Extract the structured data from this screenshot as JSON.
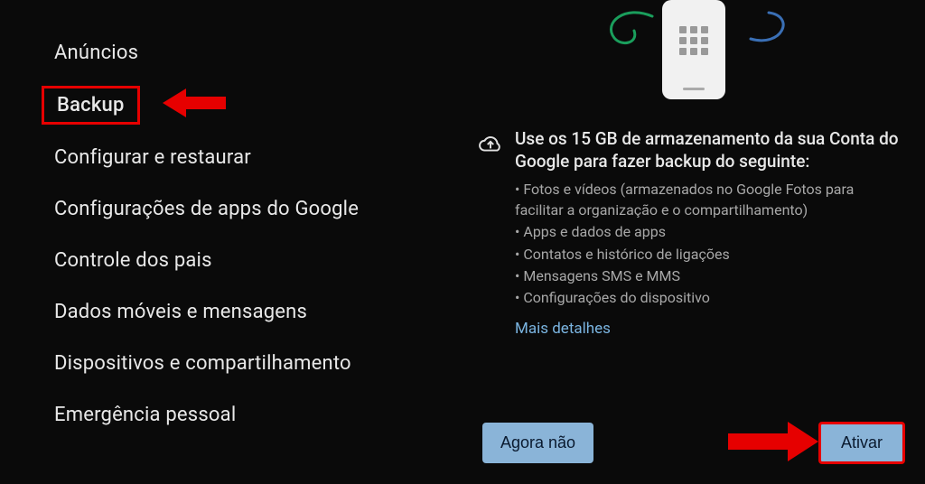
{
  "left": {
    "menu": [
      "Anúncios",
      "Backup",
      "Configurar e restaurar",
      "Configurações de apps do Google",
      "Controle dos pais",
      "Dados móveis e mensagens",
      "Dispositivos e compartilhamento",
      "Emergência pessoal"
    ],
    "highlighted_index": 1
  },
  "right": {
    "heading": "Use os 15 GB de armazenamento da sua Conta do Google para fazer backup do seguinte:",
    "bullets": [
      "Fotos e vídeos (armazenados no Google Fotos para facilitar a organização e o compartilhamento)",
      "Apps e dados de apps",
      "Contatos e histórico de ligações",
      "Mensagens SMS e MMS",
      "Configurações do dispositivo"
    ],
    "more_details": "Mais detalhes",
    "btn_skip": "Agora não",
    "btn_enable": "Ativar"
  }
}
